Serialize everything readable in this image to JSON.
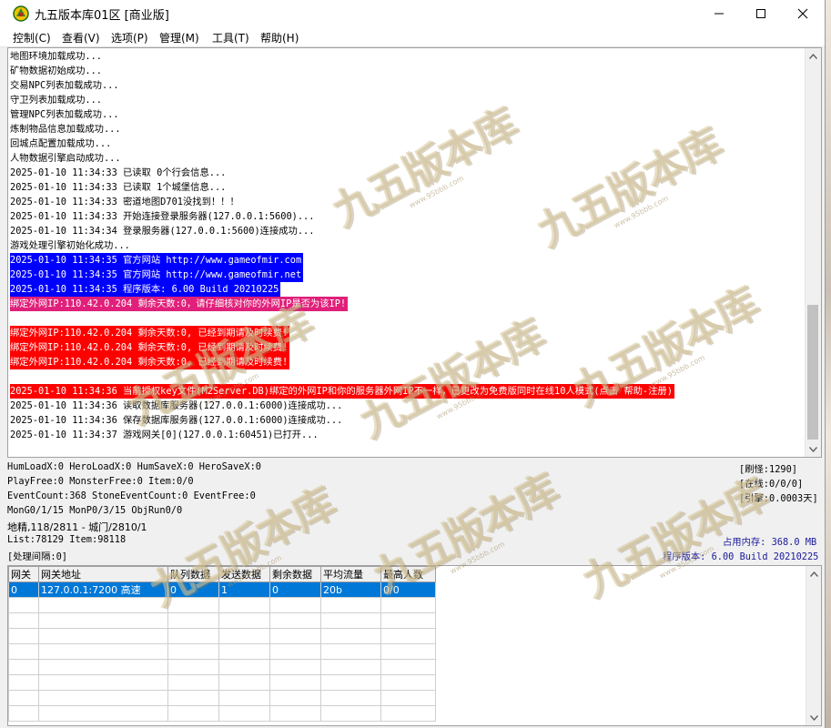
{
  "window": {
    "title": "九五版本库01区 [商业版]",
    "minimize_icon": "minimize-icon",
    "maximize_icon": "maximize-icon",
    "close_icon": "close-icon"
  },
  "menu": [
    "控制(C)",
    "查看(V)",
    "选项(P)",
    "管理(M)",
    "工具(T)",
    "帮助(H)"
  ],
  "log": [
    {
      "text": "地图环境加载成功...",
      "style": ""
    },
    {
      "text": "矿物数据初始成功...",
      "style": ""
    },
    {
      "text": "交易NPC列表加载成功...",
      "style": ""
    },
    {
      "text": "守卫列表加载成功...",
      "style": ""
    },
    {
      "text": "管理NPC列表加载成功...",
      "style": ""
    },
    {
      "text": "炼制物品信息加载成功...",
      "style": ""
    },
    {
      "text": "回城点配置加载成功...",
      "style": ""
    },
    {
      "text": "人物数据引擎启动成功...",
      "style": ""
    },
    {
      "text": "2025-01-10 11:34:33 已读取 0个行会信息...",
      "style": ""
    },
    {
      "text": "2025-01-10 11:34:33 已读取 1个城堡信息...",
      "style": ""
    },
    {
      "text": "2025-01-10 11:34:33 密道地图D701没找到！！！",
      "style": ""
    },
    {
      "text": "2025-01-10 11:34:33 开始连接登录服务器(127.0.0.1:5600)...",
      "style": ""
    },
    {
      "text": "2025-01-10 11:34:34 登录服务器(127.0.0.1:5600)连接成功...",
      "style": ""
    },
    {
      "text": "游戏处理引擎初始化成功...",
      "style": ""
    },
    {
      "text": "2025-01-10 11:34:35 官方网站 http://www.gameofmir.com",
      "style": "blue"
    },
    {
      "text": "2025-01-10 11:34:35 官方网站 http://www.gameofmir.net",
      "style": "blue"
    },
    {
      "text": "2025-01-10 11:34:35 程序版本: 6.00 Build 20210225",
      "style": "blue"
    },
    {
      "text": "绑定外网IP:110.42.0.204 剩余天数:0，请仔细核对你的外网IP是否为该IP!",
      "style": "magenta"
    },
    {
      "text": "",
      "style": ""
    },
    {
      "text": "绑定外网IP:110.42.0.204 剩余天数:0, 已经到期请及时续费!",
      "style": "red"
    },
    {
      "text": "绑定外网IP:110.42.0.204 剩余天数:0, 已经到期请及时续费!",
      "style": "red"
    },
    {
      "text": "绑定外网IP:110.42.0.204 剩余天数:0, 已经到期请及时续费!",
      "style": "red"
    },
    {
      "text": "",
      "style": ""
    },
    {
      "text": "2025-01-10 11:34:36 当前授权key文件(M2Server.DB)绑定的外网IP和你的服务器外网IP不一样，已更改为免费版同时在线10人模式(点击 帮助-注册)",
      "style": "red"
    },
    {
      "text": "2025-01-10 11:34:36 读取数据库服务器(127.0.0.1:6000)连接成功...",
      "style": ""
    },
    {
      "text": "2025-01-10 11:34:36 保存数据库服务器(127.0.0.1:6000)连接成功...",
      "style": ""
    },
    {
      "text": "2025-01-10 11:34:37 游戏网关[0](127.0.0.1:60451)已打开...",
      "style": ""
    }
  ],
  "status": {
    "line1": "HumLoadX:0 HeroLoadX:0 HumSaveX:0 HeroSaveX:0",
    "line2": "PlayFree:0 MonsterFree:0 Item:0/0",
    "line3": "EventCount:368 StoneEventCount:0 EventFree:0",
    "line4": "MonG0/1/15 MonP0/3/15 ObjRun0/0",
    "line5": "地精,118/2811 - 城门/2810/1",
    "line6": "List:78129 Item:98118",
    "line7": "[处理间隔:0]",
    "refresh": "[刷怪:1290]",
    "online": "[在线:0/0/0]",
    "engine": "[引擎:0.0003天]",
    "memory": "占用内存: 368.0 MB",
    "version": "程序版本: 6.00 Build 20210225"
  },
  "gateway_table": {
    "headers": [
      "网关",
      "网关地址",
      "队列数据",
      "发送数据",
      "剩余数据",
      "平均流量",
      "最高人数"
    ],
    "rows": [
      [
        "0",
        "127.0.0.1:7200 高速",
        "0",
        "1",
        "0",
        "20b",
        "0/0"
      ]
    ]
  },
  "watermark": {
    "main": "九五版本库",
    "sub": "www.95bbb.com"
  },
  "colors": {
    "highlight_blue": "#0000ff",
    "highlight_magenta": "#e0207a",
    "highlight_red": "#ff0000",
    "selection": "#0078d7",
    "status_blue": "#1a1a9a"
  }
}
